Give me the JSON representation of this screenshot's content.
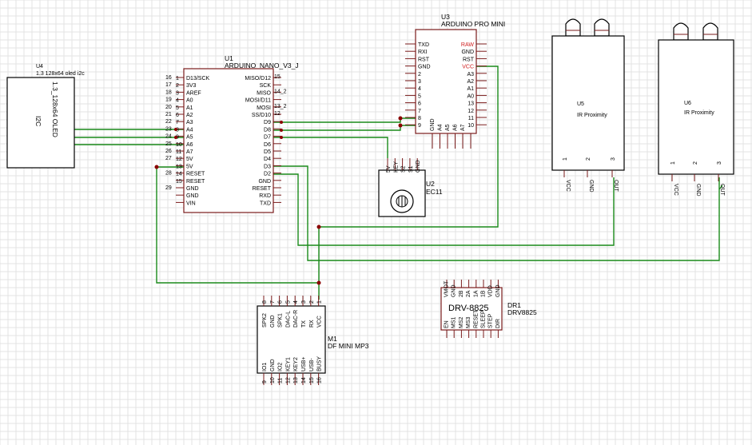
{
  "colors": {
    "wire": "#1a8a1a",
    "component": "#7a1b1b",
    "junction": "#8a0000",
    "highlight_pin": "#d02020"
  },
  "u4": {
    "ref": "U4",
    "value": "1.3 128x64 oled i2c",
    "body1": "1.3_128x64 OLED",
    "body2": "I2C"
  },
  "u1": {
    "ref": "U1",
    "value": "ARDUINO_NANO_V3_J",
    "left_labels": [
      "D13/SCK",
      "3V3",
      "AREF",
      "A0",
      "A1",
      "A2",
      "A3",
      "A4",
      "A5",
      "A6",
      "A7",
      "5V",
      "5V",
      "RESET",
      "RESET",
      "GND",
      "GND",
      "VIN"
    ],
    "left_nums": [
      "16",
      "17",
      "18",
      "19",
      "20",
      "21",
      "22",
      "23",
      "24",
      "25",
      "26",
      "27",
      "",
      "28",
      "",
      "29",
      "",
      ""
    ],
    "left_inner": [
      "1",
      "2",
      "3",
      "4",
      "5",
      "6",
      "7",
      "8",
      "9",
      "10",
      "11",
      "12",
      "13",
      "14",
      "15",
      "",
      "",
      ""
    ],
    "right_labels": [
      "MISO/D12",
      "SCK",
      "MISO",
      "MOSI/D11",
      "MOSI",
      "SS/D10",
      "D9",
      "D8",
      "D7",
      "D6",
      "D5",
      "D4",
      "D3",
      "D2",
      "GND",
      "RESET",
      "RXD",
      "TXD"
    ],
    "right_nums": [
      "15",
      "",
      "14_2",
      "",
      "13_2",
      "12",
      "",
      "",
      "",
      "",
      "",
      "",
      "",
      "",
      "",
      "",
      "",
      ""
    ]
  },
  "u3": {
    "ref": "U3",
    "value": "ARDUINO PRO MINI",
    "left_labels": [
      "TXD",
      "RXI",
      "RST",
      "GND",
      "2",
      "3",
      "4",
      "5",
      "6",
      "7",
      "8",
      "9"
    ],
    "right_labels": [
      "RAW",
      "GND",
      "RST",
      "VCC",
      "A3",
      "A2",
      "A1",
      "A0",
      "13",
      "12",
      "11",
      "10"
    ],
    "bottom_labels": [
      "GND",
      "A4",
      "A5",
      "A6",
      "A7"
    ]
  },
  "u5": {
    "ref": "U5",
    "value": "IR Proximity",
    "pin_nums": [
      "1",
      "2",
      "3"
    ],
    "pin_labels": [
      "VCC",
      "GND",
      "OUT"
    ]
  },
  "u6": {
    "ref": "U6",
    "value": "IR Proximity",
    "pin_nums": [
      "1",
      "2",
      "3"
    ],
    "pin_labels": [
      "VCC",
      "GND",
      "OUT"
    ]
  },
  "u2": {
    "ref": "U2",
    "value": "EC11",
    "pin_labels": [
      "5V",
      "KEY",
      "S2",
      "S1",
      "GND"
    ]
  },
  "m1": {
    "ref": "M1",
    "value": "DF MINI MP3",
    "top_labels": [
      "SPK2",
      "GND",
      "SPK1",
      "DAC-L",
      "DAC-R",
      "TX",
      "RX",
      "VCC"
    ],
    "top_nums": [
      "8",
      "7",
      "6",
      "5",
      "4",
      "3",
      "2",
      "1"
    ],
    "bottom_labels": [
      "IO1",
      "GND",
      "IO2",
      "KEY1",
      "KEY2",
      "USB+",
      "USB-",
      "BUSY"
    ],
    "bottom_nums": [
      "9",
      "10",
      "11",
      "12",
      "13",
      "14",
      "15",
      "16"
    ]
  },
  "dr1": {
    "ref": "DR1",
    "value": "DRV8825",
    "body": "DRV-8825",
    "top_pins": [
      "VMOT",
      "GND",
      "2B",
      "2A",
      "1A",
      "1B",
      "VDD",
      "GND"
    ],
    "bottom_pins": [
      "EN",
      "MS1",
      "MS2",
      "MS3",
      "RESET",
      "SLEEP",
      "STEP",
      "DIR"
    ]
  }
}
